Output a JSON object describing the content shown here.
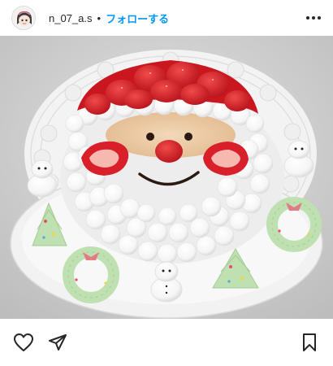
{
  "post": {
    "username": "n_07_a.s",
    "separator": "•",
    "follow_label": "フォローする"
  },
  "icons": {
    "avatar": "avatar",
    "more": "more-dots-icon",
    "like": "heart-icon",
    "share": "paper-plane-icon",
    "save": "bookmark-icon"
  },
  "colors": {
    "follow": "#0095f6",
    "text": "#262626",
    "strawberry": "#d81f2a",
    "cream": "#ffffff",
    "meringue_green": "#bfe0b0"
  }
}
